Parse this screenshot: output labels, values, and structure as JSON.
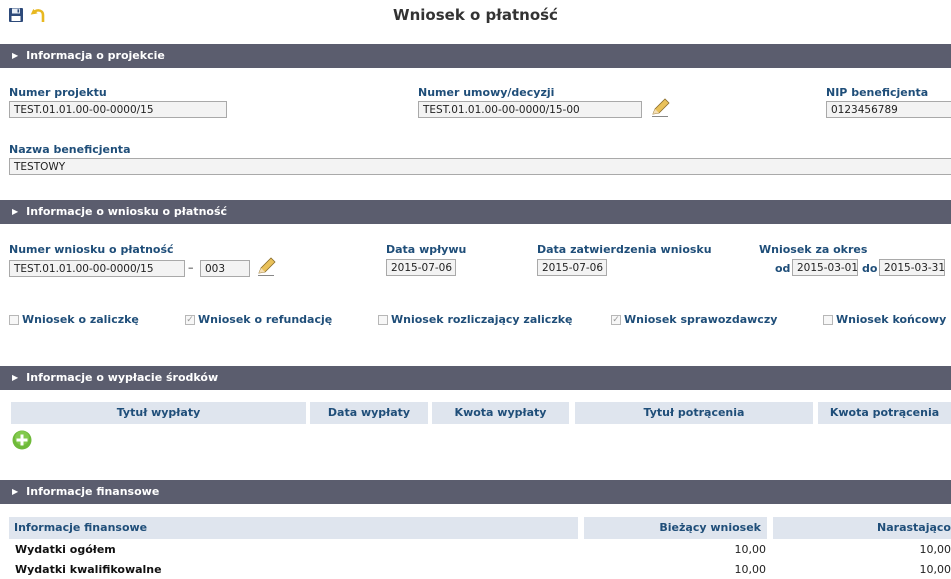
{
  "page": {
    "title": "Wniosek o płatność",
    "toolbar": {
      "save_icon": "save-icon",
      "undo_icon": "undo-icon"
    }
  },
  "sections": {
    "projekt": "Informacja o projekcie",
    "wniosek": "Informacje o wniosku o płatność",
    "wyplata": "Informacje o wypłacie środków",
    "finanse": "Informacje finansowe"
  },
  "projekt": {
    "numer_projektu_label": "Numer projektu",
    "numer_projektu": "TEST.01.01.00-00-0000/15",
    "numer_umowy_label": "Numer umowy/decyzji",
    "numer_umowy": "TEST.01.01.00-00-0000/15-00",
    "nip_label": "NIP beneficjenta",
    "nip": "0123456789",
    "nazwa_label": "Nazwa beneficjenta",
    "nazwa": "TESTOWY"
  },
  "wniosek": {
    "numer_label": "Numer wniosku o płatność",
    "numer": "TEST.01.01.00-00-0000/15",
    "separator": "–",
    "numer_suffix": "003",
    "data_wplywu_label": "Data wpływu",
    "data_wplywu": "2015-07-06",
    "data_zatw_label": "Data zatwierdzenia wniosku",
    "data_zatw": "2015-07-06",
    "okres_label": "Wniosek za okres",
    "od_label": "od",
    "od": "2015-03-01",
    "do_label": "do",
    "do": "2015-03-31",
    "checkboxes": [
      {
        "label": "Wniosek o zaliczkę",
        "checked": false
      },
      {
        "label": "Wniosek o refundację",
        "checked": true
      },
      {
        "label": "Wniosek rozliczający zaliczkę",
        "checked": false
      },
      {
        "label": "Wniosek sprawozdawczy",
        "checked": true
      },
      {
        "label": "Wniosek końcowy",
        "checked": false
      }
    ]
  },
  "wyplata": {
    "columns": [
      "Tytuł wypłaty",
      "Data wypłaty",
      "Kwota wypłaty",
      "Tytuł potrącenia",
      "Kwota potrącenia"
    ],
    "add_icon": "add-icon"
  },
  "finanse": {
    "columns": [
      "Informacje finansowe",
      "Bieżący wniosek",
      "Narastająco"
    ],
    "rows": [
      {
        "label": "Wydatki ogółem",
        "biezacy": "10,00",
        "narastajaco": "10,00"
      },
      {
        "label": "Wydatki kwalifikowalne",
        "biezacy": "10,00",
        "narastajaco": "10,00"
      }
    ]
  },
  "colors": {
    "section_bar": "#5b5d6e",
    "label_blue": "#1f4e79",
    "header_bg": "#dfe5ee",
    "add_green": "#6fba3a"
  }
}
